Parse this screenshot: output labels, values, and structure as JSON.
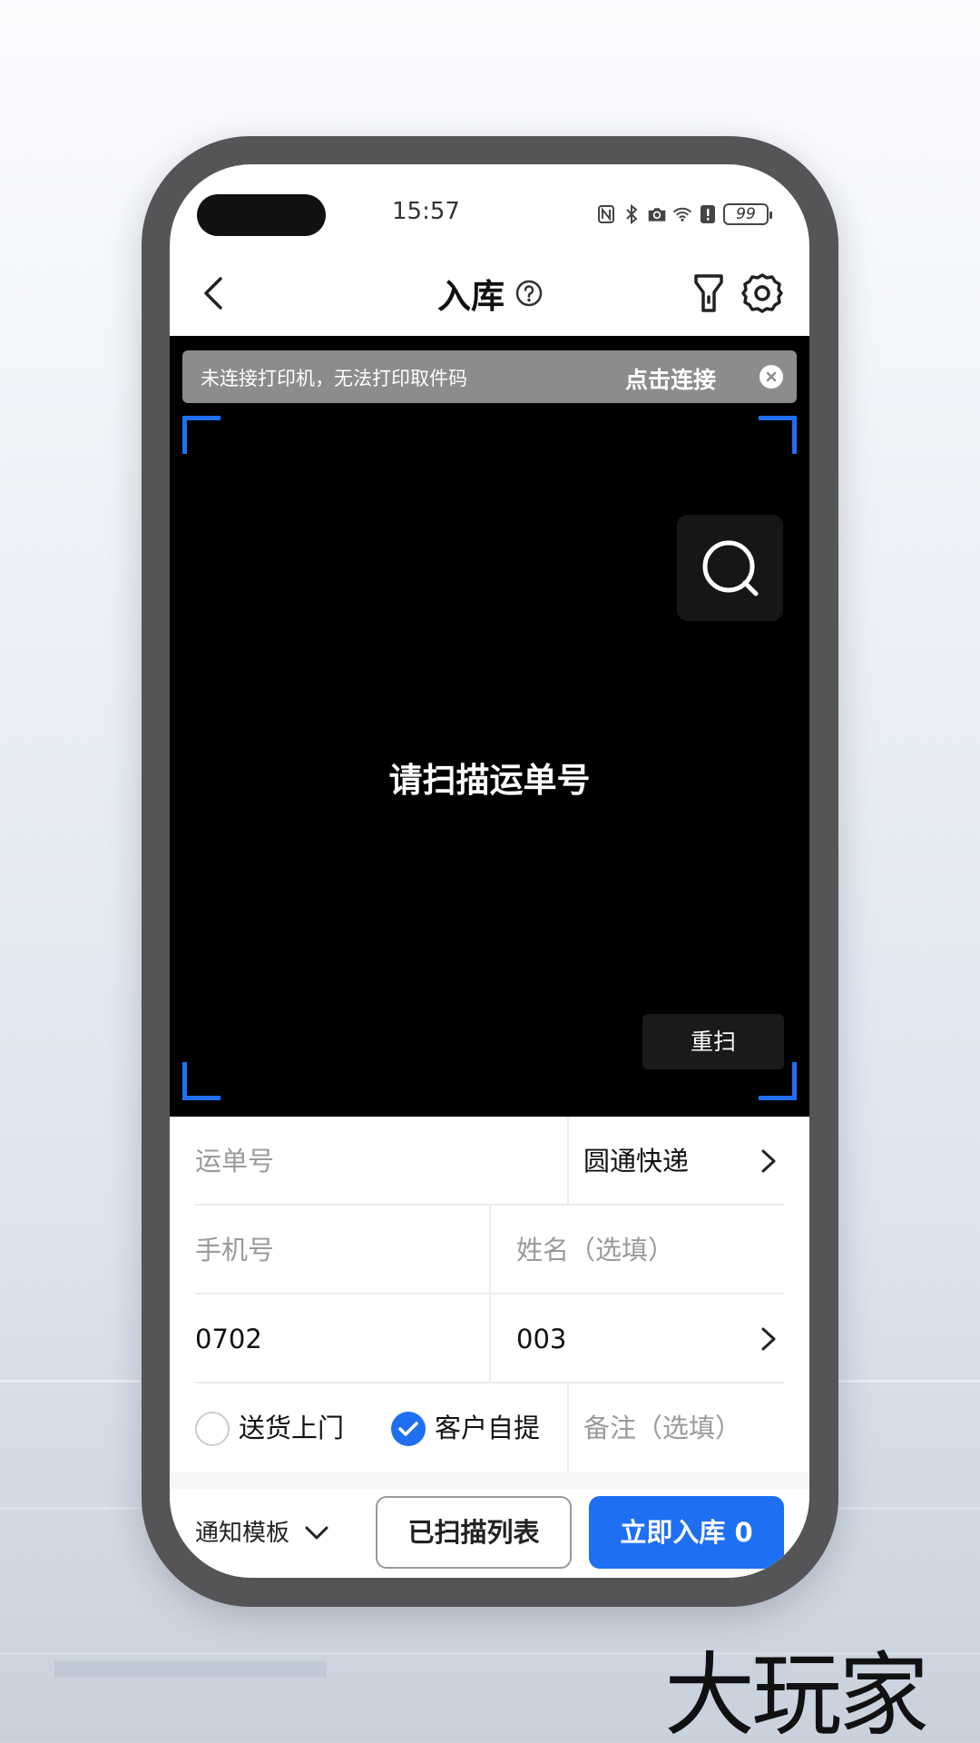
{
  "status_bar": {
    "time": "15:57",
    "battery": "99"
  },
  "nav": {
    "title": "入库"
  },
  "printer_banner": {
    "message": "未连接打印机，无法打印取件码",
    "action": "点击连接"
  },
  "scanner": {
    "prompt": "请扫描运单号",
    "rescan_label": "重扫",
    "accent_color": "#1e6ff1"
  },
  "form": {
    "waybill_placeholder": "运单号",
    "courier": "圆通快递",
    "phone_placeholder": "手机号",
    "name_placeholder": "姓名（选填）",
    "shelf": "0702",
    "code": "003",
    "delivery_options": [
      {
        "label": "送货上门",
        "checked": false
      },
      {
        "label": "客户自提",
        "checked": true
      }
    ],
    "remark_placeholder": "备注（选填）"
  },
  "bottom": {
    "template_label": "通知模板",
    "scanned_list_label": "已扫描列表",
    "stock_in_label": "立即入库 0"
  },
  "watermark": "大玩家"
}
